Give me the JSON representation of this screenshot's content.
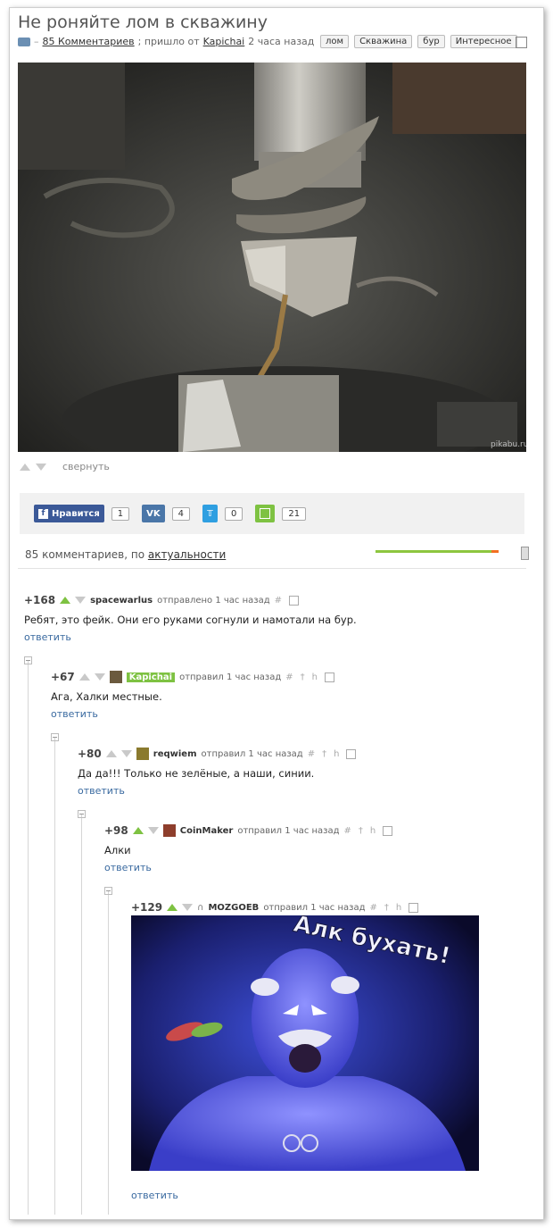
{
  "post": {
    "title": "Не роняйте лом в скважину",
    "comments_link": "85 Комментариев",
    "from_text": "; пришло от",
    "author": "Kapichai",
    "time": "2 часа назад",
    "tags": [
      "лом",
      "Скважина",
      "бур",
      "Интересное"
    ],
    "watermark": "pikabu.ru",
    "collapse_label": "свернуть"
  },
  "share": {
    "facebook_label": "Нравится",
    "facebook_count": "1",
    "vk_count": "4",
    "twitter_count": "0",
    "save_count": "21",
    "colors": {
      "facebook": "#3b5998",
      "vk": "#4a76a8",
      "twitter": "#2f9fe1",
      "save": "#7ec242"
    }
  },
  "comments_header": {
    "prefix": "85 комментариев, по",
    "sort_link": "актуальности",
    "rating_fraction": 0.94
  },
  "comments": [
    {
      "rating": "+168",
      "user": "spacewarlus",
      "action": "отправлено 1 час назад",
      "text": "Ребят, это фейк. Они его руками согнули и намотали на бур.",
      "reply": "ответить"
    },
    {
      "rating": "+67",
      "user": "Kapichai",
      "action": "отправил 1 час назад",
      "text": "Ага, Халки местные.",
      "reply": "ответить"
    },
    {
      "rating": "+80",
      "user": "reqwiem",
      "action": "отправил 1 час назад",
      "text": "Да да!!! Только не зелёные, а наши, синии.",
      "reply": "ответить"
    },
    {
      "rating": "+98",
      "user": "CoinMaker",
      "action": "отправил 1 час назад",
      "text": "Алки",
      "reply": "ответить"
    },
    {
      "rating": "+129",
      "user": "MOZGOEB",
      "action": "отправил 1 час назад",
      "meme_caption": "Алк бухать!",
      "reply": "ответить"
    }
  ],
  "icons": {
    "hash": "#",
    "save": "save-icon",
    "link": "link-icon",
    "h": "h"
  }
}
